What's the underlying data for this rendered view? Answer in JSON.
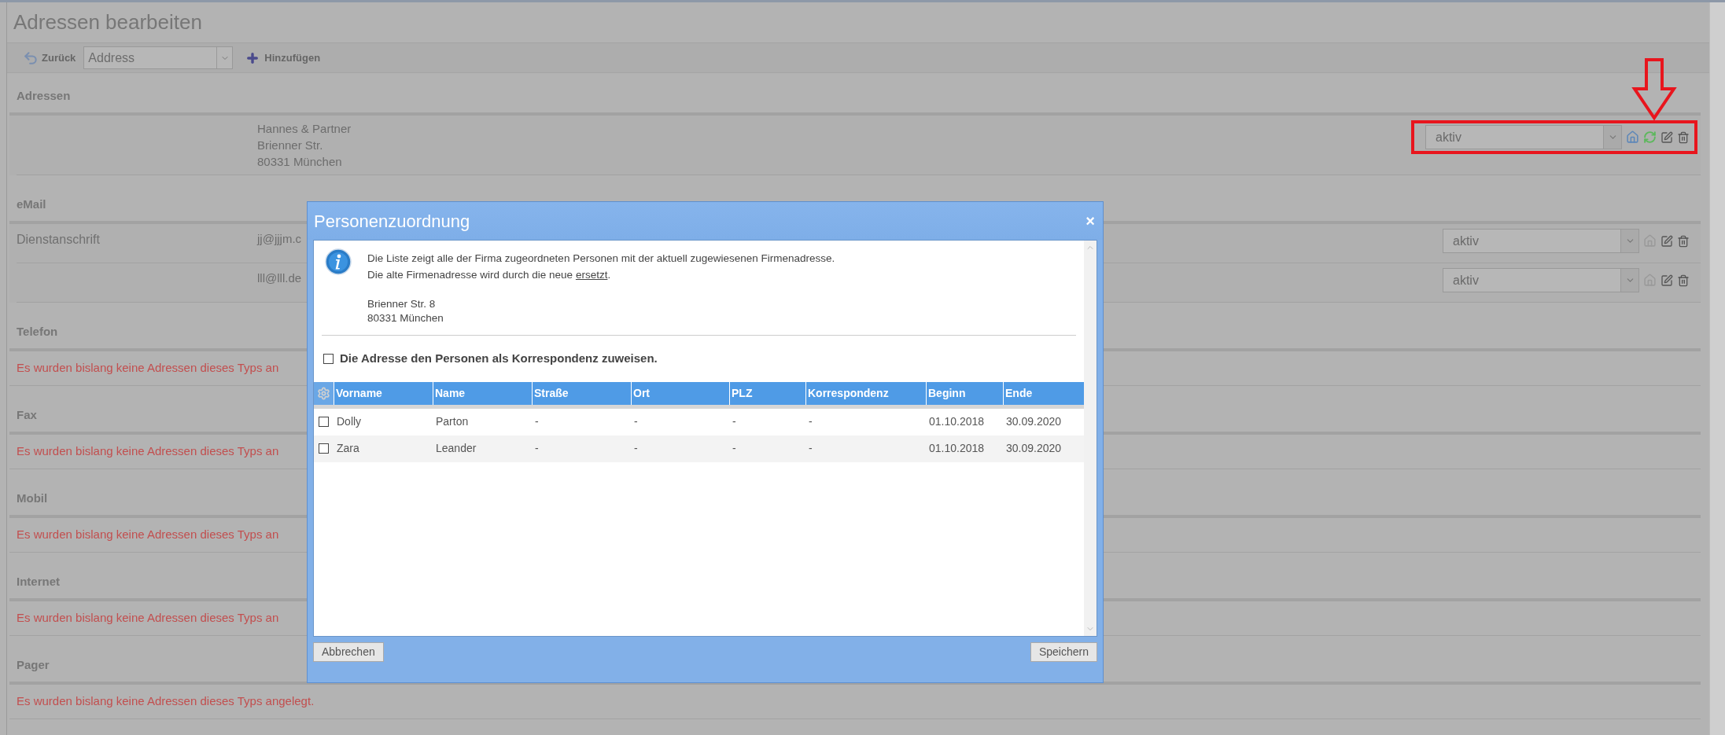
{
  "page_title": "Adressen bearbeiten",
  "toolbar": {
    "back": "Zurück",
    "type_select": "Address",
    "add": "Hinzufügen"
  },
  "sections": [
    {
      "heading": "Adressen",
      "kind": "entries",
      "entries": [
        {
          "lines": [
            "Hannes & Partner",
            "Brienner Str.",
            "80331 München"
          ],
          "status": "aktiv",
          "highlighted": true,
          "actions": [
            {
              "kind": "home",
              "disabled": false
            },
            {
              "kind": "sync",
              "disabled": false
            },
            {
              "kind": "edit",
              "disabled": false
            },
            {
              "kind": "delete",
              "disabled": false
            }
          ]
        }
      ]
    },
    {
      "heading": "eMail",
      "kind": "entries",
      "entries": [
        {
          "label": "Dienstanschrift",
          "lines": [
            "jj@jjjm.c"
          ],
          "status": "aktiv",
          "highlighted": false,
          "actions": [
            {
              "kind": "home",
              "disabled": true
            },
            {
              "kind": "edit",
              "disabled": false
            },
            {
              "kind": "delete",
              "disabled": false
            }
          ]
        },
        {
          "lines": [
            "lll@lll.de"
          ],
          "status": "aktiv",
          "highlighted": false,
          "actions": [
            {
              "kind": "home",
              "disabled": true
            },
            {
              "kind": "edit",
              "disabled": false
            },
            {
              "kind": "delete",
              "disabled": false
            }
          ]
        }
      ]
    },
    {
      "heading": "Telefon",
      "kind": "empty",
      "message": "Es wurden bislang keine Adressen dieses Typs an"
    },
    {
      "heading": "Fax",
      "kind": "empty",
      "message": "Es wurden bislang keine Adressen dieses Typs an"
    },
    {
      "heading": "Mobil",
      "kind": "empty",
      "message": "Es wurden bislang keine Adressen dieses Typs an"
    },
    {
      "heading": "Internet",
      "kind": "empty",
      "message": "Es wurden bislang keine Adressen dieses Typs an"
    },
    {
      "heading": "Pager",
      "kind": "empty",
      "message": "Es wurden bislang keine Adressen dieses Typs angelegt."
    }
  ],
  "dialog": {
    "title": "Personenzuordnung",
    "close": "×",
    "info_line": "Die Liste zeigt alle der Firma zugeordneten Personen mit der aktuell zugewiesenen Firmenadresse.",
    "info_line2": {
      "before": "Die alte Firmenadresse wird durch die neue ",
      "link": "ersetzt",
      "after": "."
    },
    "address_lines": [
      "Brienner Str. 8",
      "80331 München"
    ],
    "option": {
      "label": "Die Adresse den Personen als Korrespondenz zuweisen.",
      "checked": false
    },
    "table": {
      "columns": [
        "Vorname",
        "Name",
        "Straße",
        "Ort",
        "PLZ",
        "Korrespondenz",
        "Beginn",
        "Ende"
      ],
      "rows": [
        {
          "checked": false,
          "cells": [
            "Dolly",
            "Parton",
            "-",
            "-",
            "-",
            "-",
            "01.10.2018",
            "30.09.2020"
          ]
        },
        {
          "checked": false,
          "cells": [
            "Zara",
            "Leander",
            "-",
            "-",
            "-",
            "-",
            "01.10.2018",
            "30.09.2020"
          ]
        }
      ]
    },
    "buttons": {
      "cancel": "Abbrechen",
      "save": "Speichern"
    }
  }
}
